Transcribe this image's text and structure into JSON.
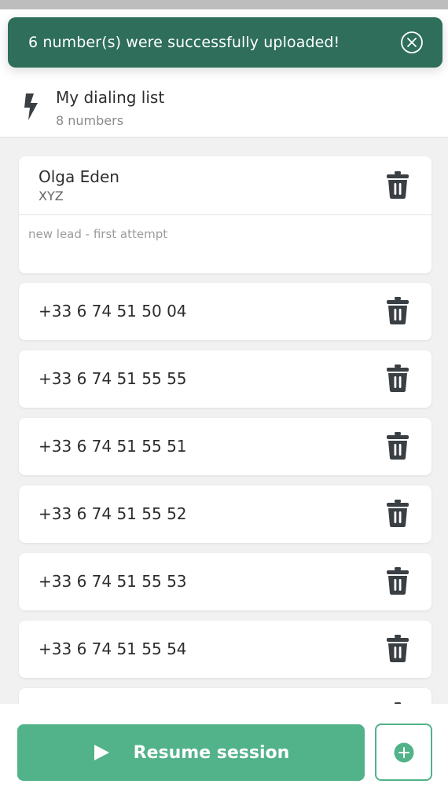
{
  "toast": {
    "message": "6 number(s) were successfully uploaded!",
    "icon": "close-circle-icon"
  },
  "list": {
    "title": "My dialing list",
    "count": "8 numbers",
    "icon": "bolt-icon"
  },
  "contact": {
    "name": "Olga Eden",
    "company": "XYZ",
    "note": "new lead - first attempt"
  },
  "numbers": [
    "+33 6 74 51 50 04",
    "+33 6 74 51 55 55",
    "+33 6 74 51 55 51",
    "+33 6 74 51 55 52",
    "+33 6 74 51 55 53",
    "+33 6 74 51 55 54"
  ],
  "footer": {
    "resume_label": "Resume session",
    "add_icon": "plus-circle-icon"
  },
  "colors": {
    "toast_bg": "#2e6e5b",
    "accent": "#52b289",
    "icon_dark": "#3a3f44"
  }
}
